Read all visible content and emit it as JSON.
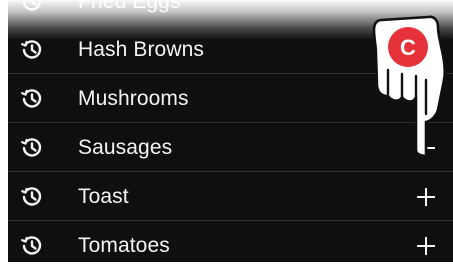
{
  "list": {
    "partial_item": {
      "label": "Fried Eggs"
    },
    "items": [
      {
        "label": "Hash Browns",
        "icon": "history-icon",
        "action": ""
      },
      {
        "label": "Mushrooms",
        "icon": "history-icon",
        "action": ""
      },
      {
        "label": "Sausages",
        "icon": "history-icon",
        "action": "add-icon"
      },
      {
        "label": "Toast",
        "icon": "history-icon",
        "action": "add-icon"
      },
      {
        "label": "Tomatoes",
        "icon": "history-icon",
        "action": "add-icon"
      }
    ]
  },
  "overlay": {
    "hand_icon": "pointing-hand-icon",
    "badge_letter": "C",
    "badge_color": "#e5323a"
  },
  "colors": {
    "background": "#0f0f0f",
    "text": "#f4f4f4",
    "divider": "#2e2e2e"
  }
}
